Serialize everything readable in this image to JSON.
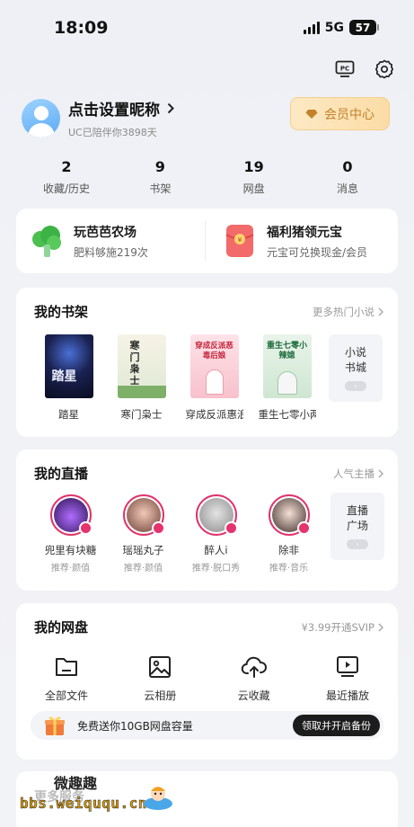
{
  "status_bar": {
    "time": "18:09",
    "network": "5G",
    "battery": "57"
  },
  "top_icons": [
    "pc-icon",
    "gear-icon"
  ],
  "profile": {
    "nickname": "点击设置昵称",
    "subtitle": "UC已陪伴你3898天",
    "vip_label": "会员中心"
  },
  "stats": [
    {
      "value": "2",
      "label": "收藏/历史"
    },
    {
      "value": "9",
      "label": "书架"
    },
    {
      "value": "19",
      "label": "网盘"
    },
    {
      "value": "0",
      "label": "消息"
    }
  ],
  "promo": [
    {
      "title": "玩芭芭农场",
      "subtitle": "肥料够施219次"
    },
    {
      "title": "福利猪领元宝",
      "subtitle": "元宝可兑换现金/会员"
    }
  ],
  "bookshelf": {
    "title": "我的书架",
    "more": "更多热门小说",
    "books": [
      {
        "name": "踏星",
        "cover_text": "踏星"
      },
      {
        "name": "寒门枭士",
        "cover_text": "寒门枭士"
      },
      {
        "name": "穿成反派惠浪",
        "cover_text": "穿成反派恶毒后娘"
      },
      {
        "name": "重生七零小两",
        "cover_text": "重生七零小辣媳"
      }
    ],
    "more_tile": {
      "line1": "小说",
      "line2": "书城"
    }
  },
  "live": {
    "title": "我的直播",
    "more": "人气主播",
    "hosts": [
      {
        "name": "兜里有块糖",
        "tag": "推荐·颜值"
      },
      {
        "name": "瑶瑶丸子",
        "tag": "推荐·颜值"
      },
      {
        "name": "醉人i",
        "tag": "推荐·脱口秀"
      },
      {
        "name": "除非",
        "tag": "推荐·音乐"
      }
    ],
    "more_tile": {
      "line1": "直播",
      "line2": "广场"
    }
  },
  "netdisk": {
    "title": "我的网盘",
    "more": "¥3.99开通SVIP",
    "items": [
      {
        "label": "全部文件",
        "icon": "folder-icon"
      },
      {
        "label": "云相册",
        "icon": "photo-icon"
      },
      {
        "label": "云收藏",
        "icon": "cloud-upload-icon"
      },
      {
        "label": "最近播放",
        "icon": "play-screen-icon"
      }
    ],
    "banner_text": "免费送你10GB网盘容量",
    "banner_cta": "领取并开启备份"
  },
  "bottom_card_title": "更多服务",
  "watermark": {
    "line1": "微趣趣",
    "line2": "bbs.weiququ.cn"
  },
  "colors": {
    "accent_red": "#e6336d",
    "vip_gold": "#c1822a",
    "background": "#f1f2f6"
  }
}
